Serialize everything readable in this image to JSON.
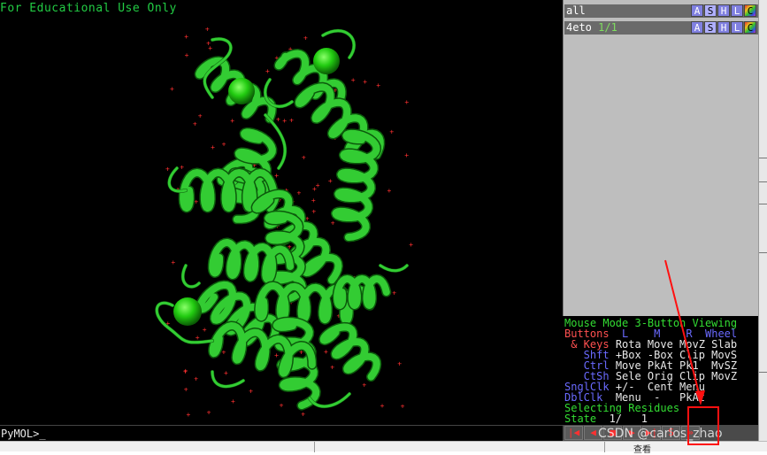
{
  "viewer": {
    "banner": "For Educational Use Only",
    "prompt": "PyMOL>_"
  },
  "objects": [
    {
      "name": "all",
      "state": "",
      "buttons": [
        "A",
        "S",
        "H",
        "L",
        "C"
      ]
    },
    {
      "name": "4eto",
      "state": "1/1",
      "buttons": [
        "A",
        "S",
        "H",
        "L",
        "C"
      ]
    }
  ],
  "mouse_panel": {
    "mode_line": "Mouse Mode 3-Button Viewing",
    "header": {
      "buttons": "Buttons",
      "l": "L",
      "m": "M",
      "r": "R",
      "wheel": "Wheel"
    },
    "rows": [
      {
        "key": " & Keys",
        "vals": "Rota Move MovZ Slab"
      },
      {
        "key": "   Shft",
        "vals": "+Box -Box Clip MovS"
      },
      {
        "key": "   Ctrl",
        "vals": "Move PkAt Pk1  MvSZ"
      },
      {
        "key": "   CtSh",
        "vals": "Sele Orig Clip MovZ"
      },
      {
        "key": "SnglClk",
        "vals": "+/-  Cent Menu"
      },
      {
        "key": "DblClk",
        "vals": "Menu  -   PkAt"
      }
    ],
    "selecting": "Selecting Residues",
    "state_label": "State",
    "state_value": "  1/   1"
  },
  "controls": [
    "|◀",
    "◀",
    "■",
    "▶",
    "▶|",
    "S",
    "»"
  ],
  "below_text": "查看",
  "watermark": "CSDN @carlos_zhao",
  "colors": {
    "ribbon": "#33cc33",
    "background": "#000000",
    "panel": "#bebebe",
    "highlight": "#ff1010"
  }
}
